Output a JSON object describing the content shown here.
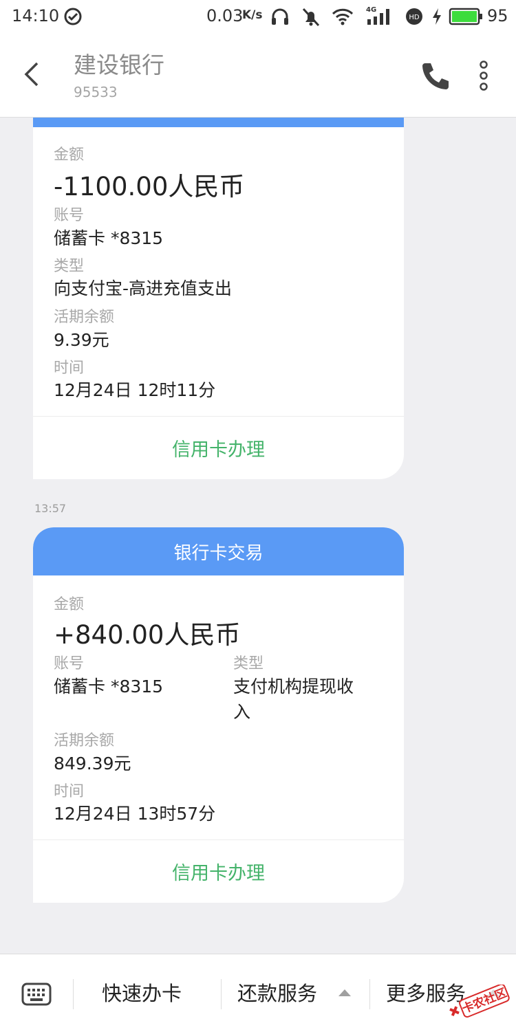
{
  "status_bar": {
    "time": "14:10",
    "net_speed": "0.03",
    "speed_unit": "K/s",
    "network": "4G",
    "battery": "95"
  },
  "header": {
    "title": "建设银行",
    "number": "95533"
  },
  "card1": {
    "amount_label": "金额",
    "amount": "-1100.00人民币",
    "account_label": "账号",
    "account": "储蓄卡 *8315",
    "type_label": "类型",
    "type": "向支付宝-高进充值支出",
    "balance_label": "活期余额",
    "balance": "9.39元",
    "time_label": "时间",
    "time": "12月24日 12时11分",
    "action": "信用卡办理"
  },
  "timestamp": "13:57",
  "card2": {
    "header": "银行卡交易",
    "amount_label": "金额",
    "amount": "+840.00人民币",
    "account_label": "账号",
    "account": "储蓄卡 *8315",
    "type_label": "类型",
    "type_line1": "支付机构提现收",
    "type_line2": "入",
    "balance_label": "活期余额",
    "balance": "849.39元",
    "time_label": "时间",
    "time": "12月24日 13时57分",
    "action": "信用卡办理"
  },
  "bottom_bar": {
    "item1": "快速办卡",
    "item2": "还款服务",
    "item3": "更多服务"
  },
  "watermark": "卡农社区"
}
